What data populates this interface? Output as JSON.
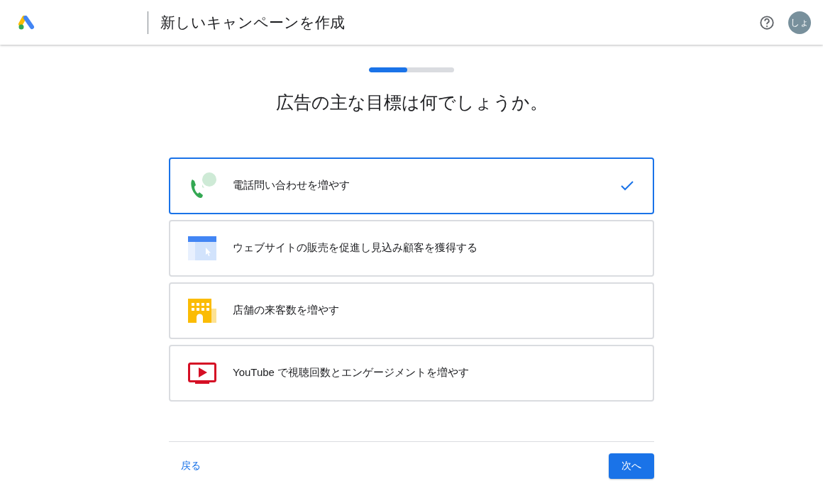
{
  "header": {
    "title": "新しいキャンペーンを作成",
    "avatar": "しょ"
  },
  "progress": {
    "level": 0.45
  },
  "heading": "広告の主な目標は何でしょうか。",
  "goals": [
    {
      "kind": "phone",
      "label": "電話問い合わせを増やす",
      "selected": true
    },
    {
      "kind": "website",
      "label": "ウェブサイトの販売を促進し見込み顧客を獲得する",
      "selected": false
    },
    {
      "kind": "store",
      "label": "店舗の来客数を増やす",
      "selected": false
    },
    {
      "kind": "video",
      "label": "YouTube で視聴回数とエンゲージメントを増やす",
      "selected": false
    }
  ],
  "footer": {
    "back": "戻る",
    "next": "次へ"
  }
}
